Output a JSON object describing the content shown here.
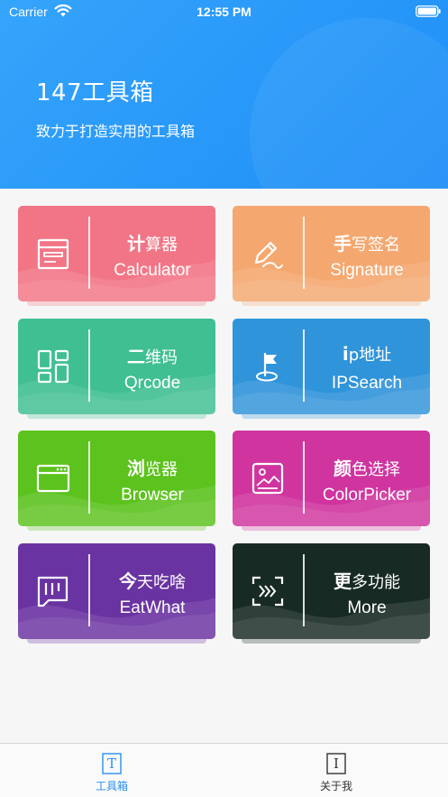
{
  "status_bar": {
    "carrier": "Carrier",
    "time": "12:55 PM"
  },
  "header": {
    "title": "147工具箱",
    "subtitle": "致力于打造实用的工具箱"
  },
  "tools": [
    {
      "cn_first": "计",
      "cn_rest": "算器",
      "en": "Calculator",
      "icon": "calculator-icon",
      "color": "#f27586"
    },
    {
      "cn_first": "手",
      "cn_rest": "写签名",
      "en": "Signature",
      "icon": "pen-icon",
      "color": "#f4a870"
    },
    {
      "cn_first": "二",
      "cn_rest": "维码",
      "en": "Qrcode",
      "icon": "qrcode-icon",
      "color": "#3fbf92"
    },
    {
      "cn_first": "i",
      "cn_rest": "p地址",
      "en": "IPSearch",
      "icon": "location-flag-icon",
      "color": "#2f94da"
    },
    {
      "cn_first": "浏",
      "cn_rest": "览器",
      "en": "Browser",
      "icon": "browser-window-icon",
      "color": "#5cc21d"
    },
    {
      "cn_first": "颜",
      "cn_rest": "色选择",
      "en": "ColorPicker",
      "icon": "image-picture-icon",
      "color": "#d0349f"
    },
    {
      "cn_first": "今",
      "cn_rest": "天吃啥",
      "en": "EatWhat",
      "icon": "menu-list-icon",
      "color": "#6a33a2"
    },
    {
      "cn_first": "更",
      "cn_rest": "多功能",
      "en": "More",
      "icon": "scan-more-icon",
      "color": "#182a24"
    }
  ],
  "tabbar": {
    "tabs": [
      {
        "label": "工具箱",
        "icon": "toolbox-tab-icon",
        "active": true
      },
      {
        "label": "关于我",
        "icon": "about-tab-icon",
        "active": false
      }
    ],
    "active_color": "#2b8ff0",
    "inactive_color": "#333333"
  }
}
